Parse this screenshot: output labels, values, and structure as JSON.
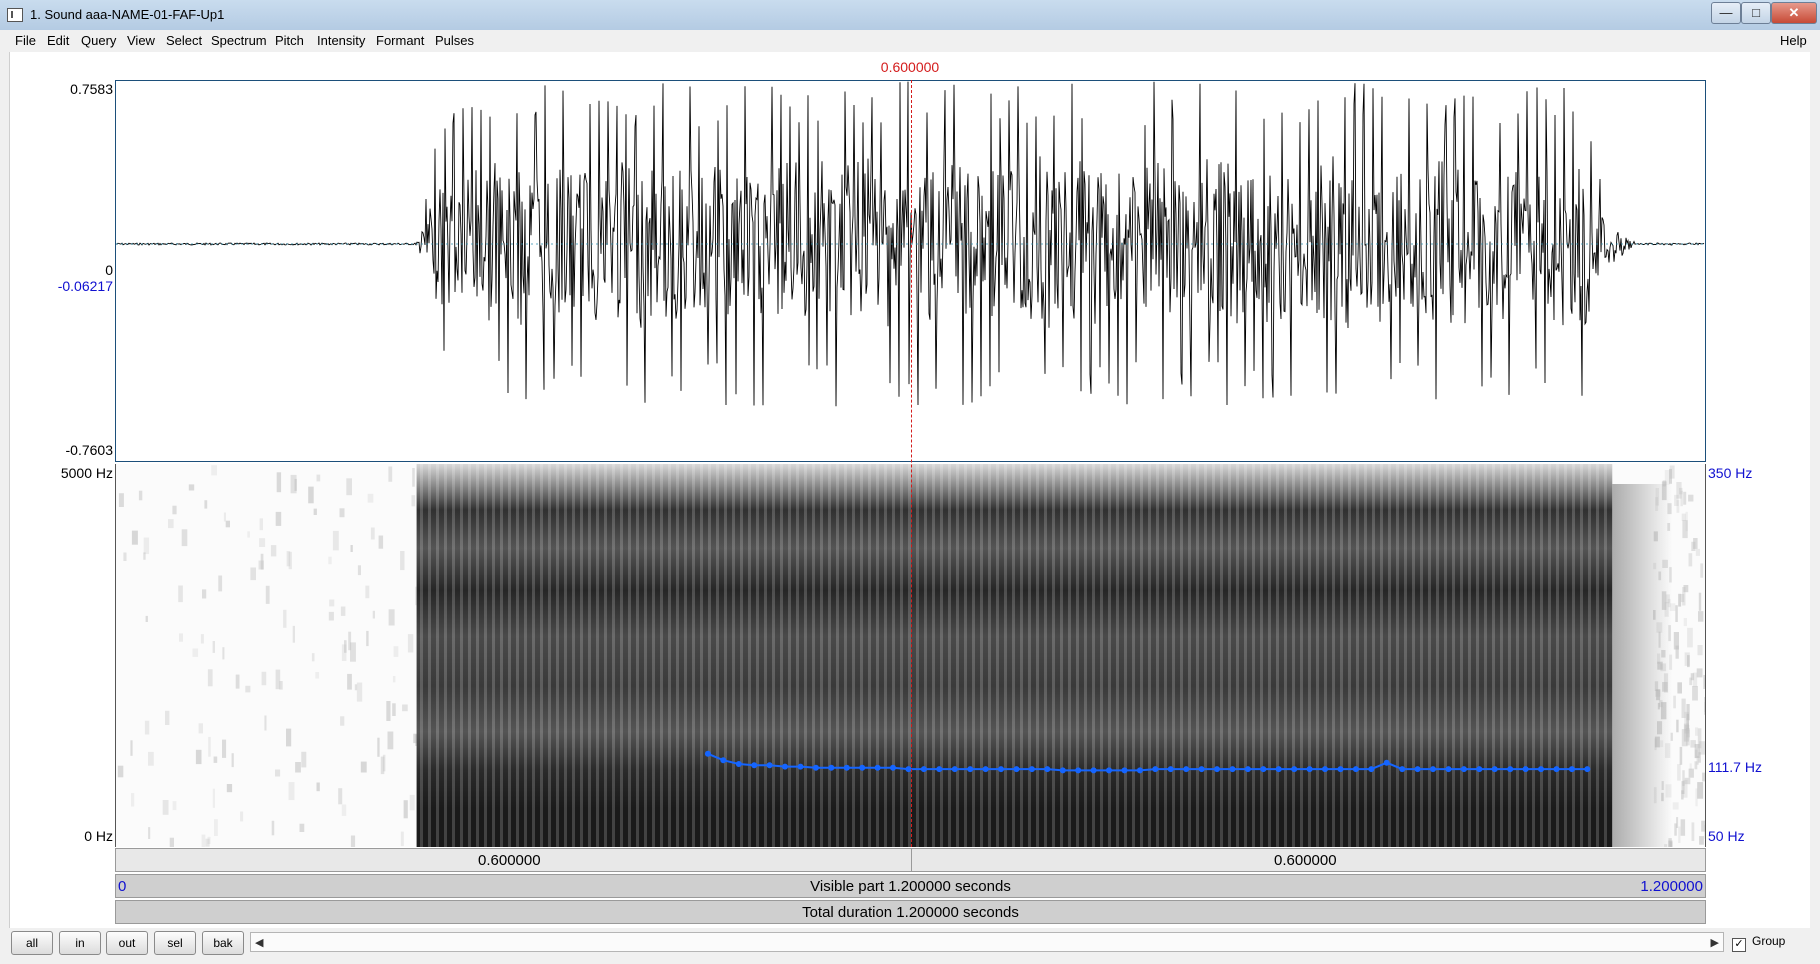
{
  "window": {
    "title": "1. Sound aaa-NAME-01-FAF-Up1",
    "minimize": "—",
    "maximize": "□",
    "close": "✕"
  },
  "menubar": {
    "items": [
      "File",
      "Edit",
      "Query",
      "View",
      "Select",
      "Spectrum",
      "Pitch",
      "Intensity",
      "Formant",
      "Pulses"
    ],
    "help": "Help"
  },
  "cursor": {
    "time": "0.600000"
  },
  "waveform": {
    "ymax": "0.7583",
    "zero": "0",
    "cursor_value": "-0.06217",
    "ymin": "-0.7603",
    "voiced_start_s": 0.227,
    "voiced_end_s": 1.13
  },
  "spectrogram": {
    "freq_max": "5000 Hz",
    "freq_min": "0 Hz",
    "pitch_max": "350 Hz",
    "pitch_value": "111.7 Hz",
    "pitch_min": "50 Hz"
  },
  "time_strip": {
    "left_interval": "0.600000",
    "right_interval": "0.600000"
  },
  "visible_strip": {
    "start": "0",
    "label": "Visible part 1.200000 seconds",
    "end": "1.200000"
  },
  "total_strip": {
    "label": "Total duration 1.200000 seconds"
  },
  "buttons": {
    "all": "all",
    "in": "in",
    "out": "out",
    "sel": "sel",
    "bak": "bak"
  },
  "group": {
    "label": "Group",
    "checked": "✓"
  },
  "pitch_contour_hz": [
    123,
    118,
    115,
    114,
    114,
    113,
    113,
    112,
    112,
    112,
    112,
    112,
    112,
    111,
    111,
    111,
    111,
    111,
    111,
    111,
    111,
    111,
    111,
    110,
    110,
    110,
    110,
    110,
    110,
    111,
    111,
    111,
    111,
    111,
    111,
    111,
    111,
    111,
    111,
    111,
    111,
    111,
    111,
    111,
    116,
    111,
    111,
    111,
    111,
    111,
    111,
    111,
    111,
    111,
    111,
    111,
    111,
    111
  ],
  "colors": {
    "cursor": "#d41c1c",
    "pitch": "#1565ff",
    "waveform": "#000000",
    "frame": "#1c4f7a"
  }
}
